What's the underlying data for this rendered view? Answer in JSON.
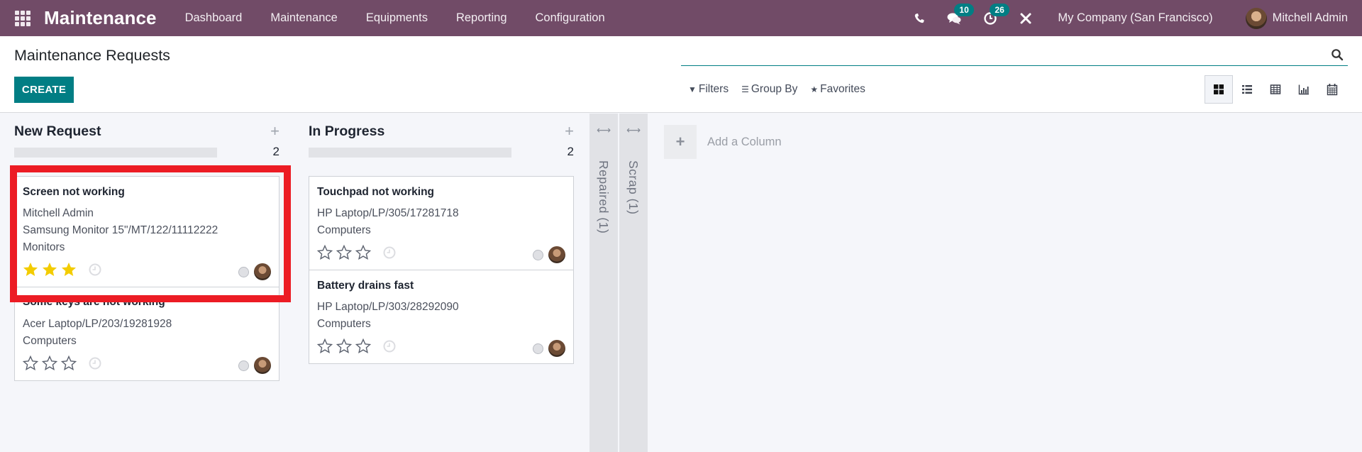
{
  "navbar": {
    "app_name": "Maintenance",
    "menu": [
      "Dashboard",
      "Maintenance",
      "Equipments",
      "Reporting",
      "Configuration"
    ],
    "messages_count": "10",
    "activities_count": "26",
    "company": "My Company (San Francisco)",
    "user": "Mitchell Admin",
    "icons": [
      "apps-icon",
      "phone-icon",
      "chat-icon",
      "clock-activity-icon",
      "tools-icon"
    ]
  },
  "control_panel": {
    "title": "Maintenance Requests",
    "create_label": "CREATE",
    "search_placeholder": "",
    "filters_label": "Filters",
    "groupby_label": "Group By",
    "favorites_label": "Favorites",
    "views": [
      "kanban",
      "list",
      "pivot",
      "graph",
      "calendar"
    ],
    "active_view": "kanban"
  },
  "kanban": {
    "columns": [
      {
        "title": "New Request",
        "count": "2",
        "cards": [
          {
            "title": "Screen not working",
            "lines": [
              "Mitchell Admin",
              "Samsung Monitor 15\"/MT/122/11112222",
              "Monitors"
            ],
            "priority": 3
          },
          {
            "title": "Some keys are not working",
            "lines": [
              "Acer Laptop/LP/203/19281928",
              "Computers"
            ],
            "priority": 0
          }
        ]
      },
      {
        "title": "In Progress",
        "count": "2",
        "cards": [
          {
            "title": "Touchpad not working",
            "lines": [
              "HP Laptop/LP/305/17281718",
              "Computers"
            ],
            "priority": 0
          },
          {
            "title": "Battery drains fast",
            "lines": [
              "HP Laptop/LP/303/28292090",
              "Computers"
            ],
            "priority": 0
          }
        ]
      }
    ],
    "folded_columns": [
      "Repaired (1)",
      "Scrap (1)"
    ],
    "add_column_label": "Add a Column"
  },
  "colors": {
    "brand": "#714b67",
    "accent": "#017e84",
    "star_filled": "#f3cc00",
    "highlight": "#ec1c24"
  }
}
